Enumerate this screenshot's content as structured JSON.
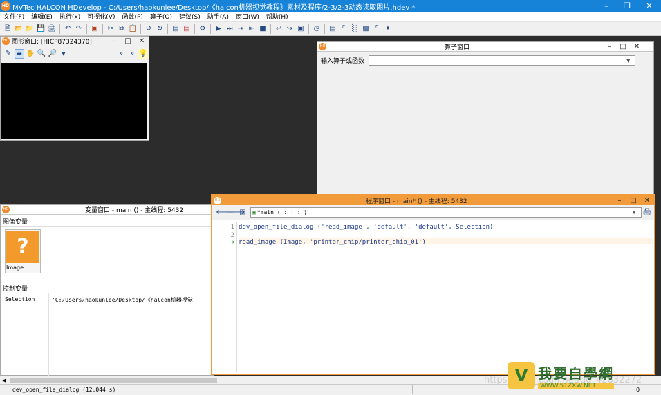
{
  "window": {
    "title": "MVTec HALCON HDevelop - C:/Users/haokunlee/Desktop/《halcon机器视觉教程》素材及程序/2-3/2-3动态读取图片.hdev *",
    "logo": "HD"
  },
  "menu": [
    "文件(F)",
    "编辑(E)",
    "执行(x)",
    "可视化(V)",
    "函数(P)",
    "算子(O)",
    "建议(S)",
    "助手(A)",
    "窗口(W)",
    "帮助(H)"
  ],
  "graphics_window": {
    "title": "图形窗口: [HICP87324370]",
    "tools": [
      "edit-icon",
      "pointer-icon",
      "hand-icon",
      "magnify-icon",
      "zoom-icon",
      "bulb-icon"
    ]
  },
  "operator_window": {
    "title": "算子窗口",
    "input_label": "输入算子或函数",
    "input_value": ""
  },
  "variable_window": {
    "title": "变量窗口 - main () - 主线程: 5432",
    "image_section": "图像变量",
    "image_var_name": "Image",
    "control_section": "控制变量",
    "control_vars": [
      {
        "name": "Selection",
        "value": "'C:/Users/haokunlee/Desktop/《halcon机器视觉"
      }
    ]
  },
  "program_window": {
    "title": "程序窗口 - main* () - 主线程: 5432",
    "procedure": "*main ( : : : )",
    "lines": [
      {
        "num": "1",
        "text": "dev_open_file_dialog ('read_image', 'default', 'default', Selection)"
      },
      {
        "num": "2",
        "text": ""
      },
      {
        "num": "",
        "text": "read_image (Image, 'printer_chip/printer_chip_01')"
      }
    ]
  },
  "status": {
    "message": "dev_open_file_dialog (12.044 s)",
    "coords": "0"
  },
  "watermark": {
    "url": "https://blog.csdn.net/qq_42832272",
    "brand": "我要自學網",
    "site": "WWW.51ZXW.NET"
  },
  "colors": {
    "titlebar": "#1683d8",
    "accent_orange": "#f29b3a",
    "workspace": "#2c2c2c"
  }
}
